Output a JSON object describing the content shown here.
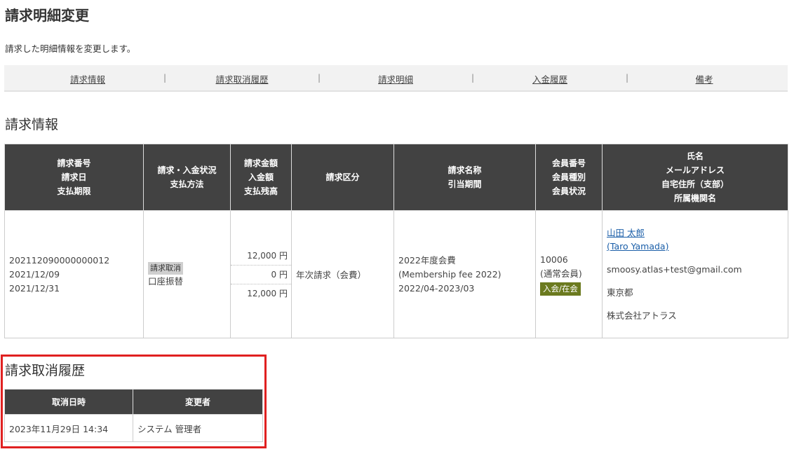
{
  "page": {
    "title": "請求明細変更",
    "description": "請求した明細情報を変更します。"
  },
  "tabs": [
    "請求情報",
    "請求取消履歴",
    "請求明細",
    "入金履歴",
    "備考"
  ],
  "tab_separator": "|",
  "billing_section": {
    "title": "請求情報",
    "headers": [
      [
        "請求番号",
        "請求日",
        "支払期限"
      ],
      [
        "請求・入金状況",
        "支払方法"
      ],
      [
        "請求金額",
        "入金額",
        "支払残高"
      ],
      [
        "請求区分"
      ],
      [
        "請求名称",
        "引当期間"
      ],
      [
        "会員番号",
        "会員種別",
        "会員状況"
      ],
      [
        "氏名",
        "メールアドレス",
        "自宅住所（支部）",
        "所属機関名"
      ]
    ],
    "row": {
      "bill_number": "202112090000000012",
      "bill_date": "2021/12/09",
      "due_date": "2021/12/31",
      "status_badge": "請求取消",
      "payment_method": "口座振替",
      "billed_amount": "12,000 円",
      "paid_amount": "0 円",
      "balance": "12,000 円",
      "category": "年次請求（会費）",
      "bill_name": "2022年度会費",
      "bill_name_en": "(Membership fee 2022)",
      "period": "2022/04-2023/03",
      "member_number": "10006",
      "member_type": "(通常会員)",
      "member_status": "入会/在会",
      "name": "山田 太郎",
      "name_en": "(Taro Yamada)",
      "email": "smoosy.atlas+test@gmail.com",
      "address": "東京都",
      "organization": "株式会社アトラス"
    }
  },
  "cancel_section": {
    "title": "請求取消履歴",
    "headers": [
      "取消日時",
      "変更者"
    ],
    "rows": [
      {
        "datetime": "2023年11月29日 14:34",
        "changed_by": "システム 管理者"
      }
    ]
  },
  "colors": {
    "header_bg": "#424242",
    "highlight_border": "#e02020",
    "status_badge_green": "#6b7a1f",
    "status_badge_gray": "#cfcfcf",
    "link": "#1a5ea8"
  }
}
